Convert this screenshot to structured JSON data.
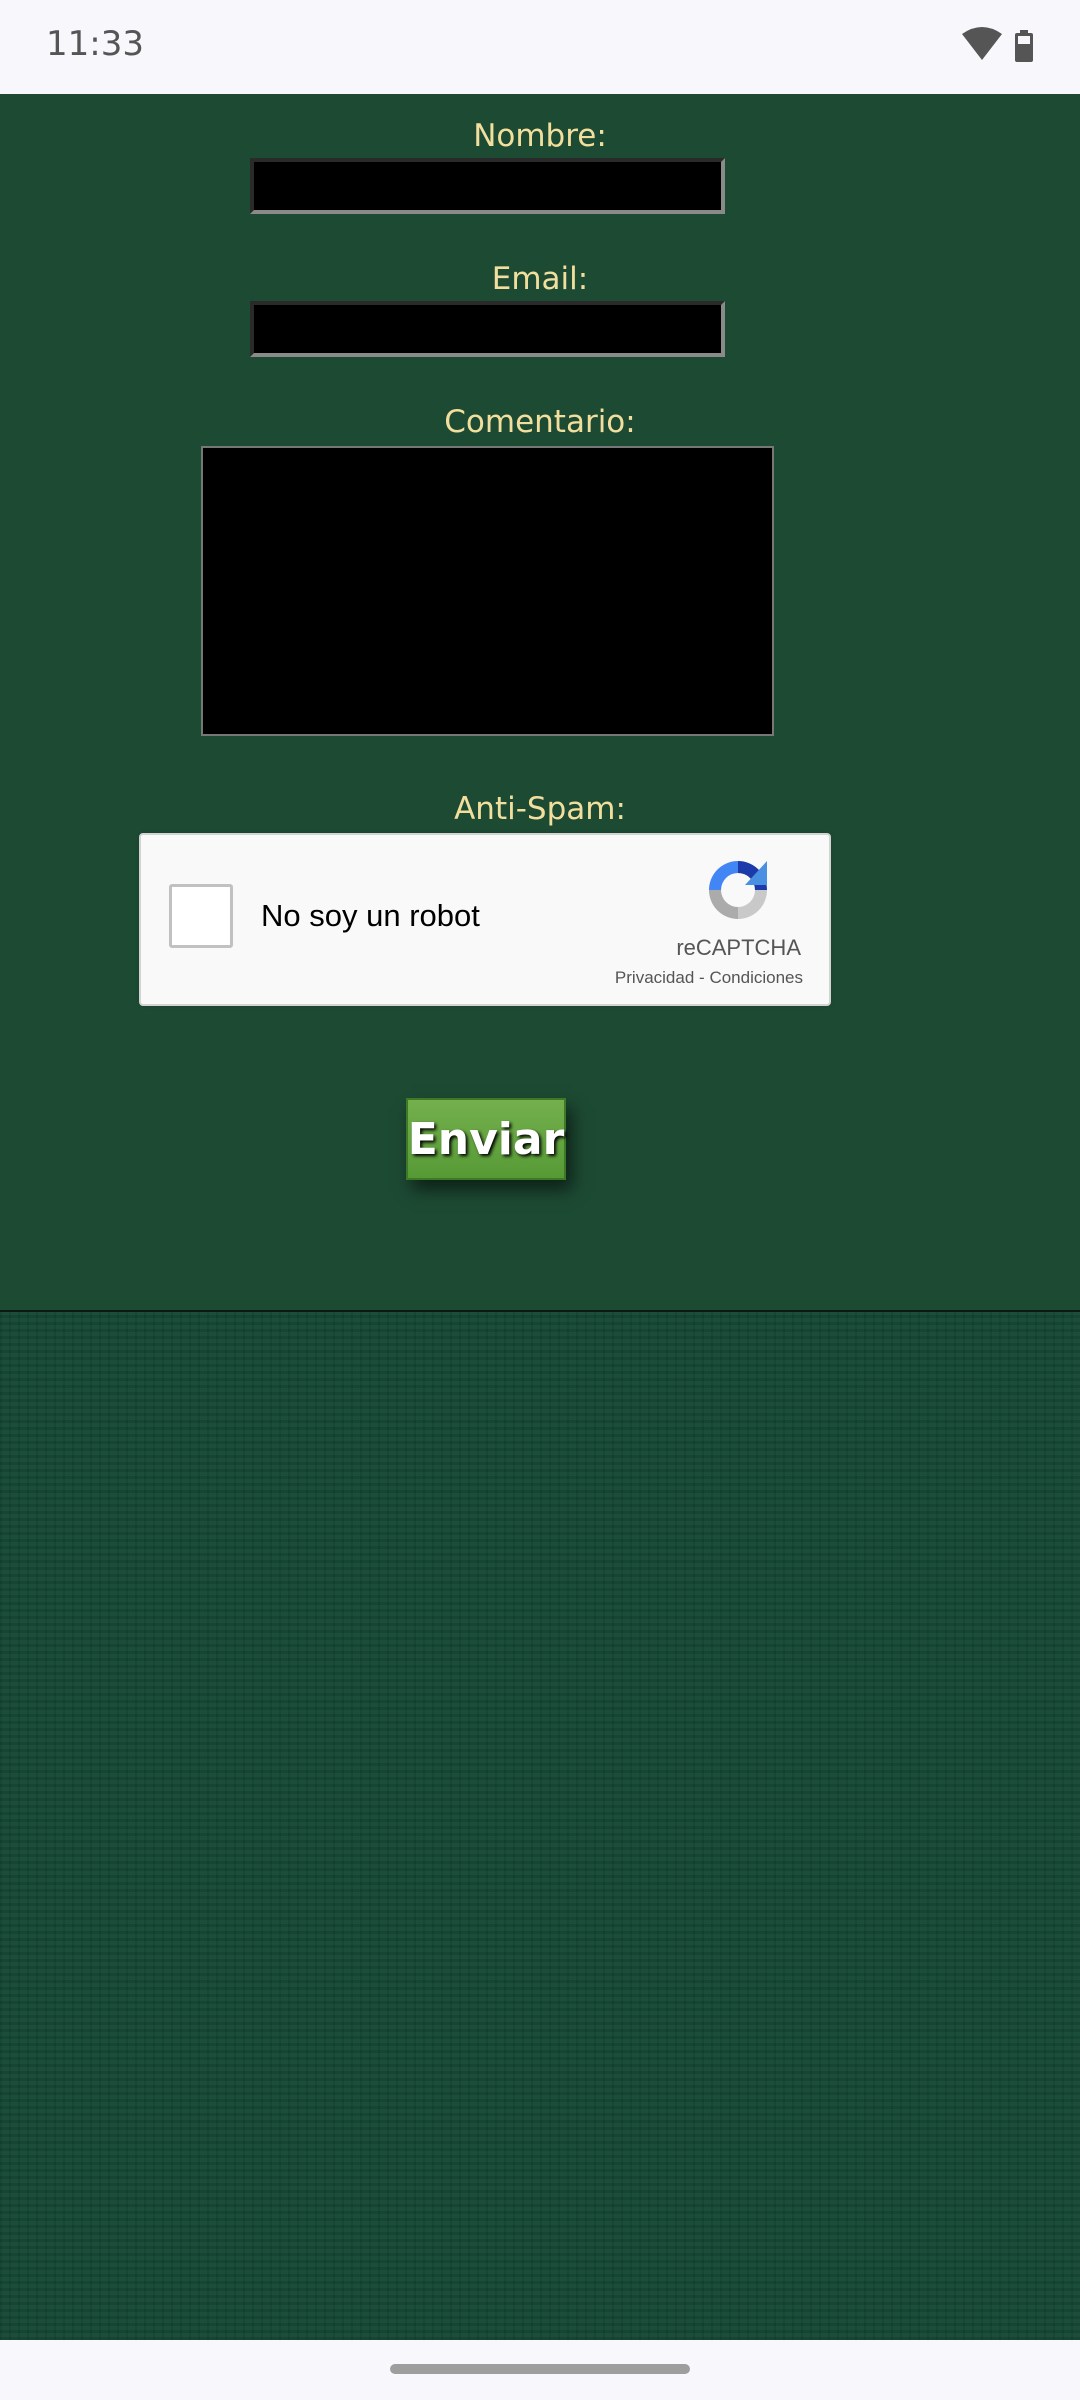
{
  "status_bar": {
    "time": "11:33"
  },
  "form": {
    "nombre_label": "Nombre:",
    "nombre_value": "",
    "email_label": "Email:",
    "email_value": "",
    "comentario_label": "Comentario:",
    "comentario_value": "",
    "antispam_label": "Anti-Spam:",
    "submit_label": "Enviar"
  },
  "recaptcha": {
    "checkbox_label": "No soy un robot",
    "checked": false,
    "brand": "reCAPTCHA",
    "privacy_link": "Privacidad",
    "separator": "-",
    "terms_link": "Condiciones"
  },
  "colors": {
    "panel_bg": "#1d4a33",
    "label_color": "#f2df9e",
    "button_green": "#6aa844"
  }
}
